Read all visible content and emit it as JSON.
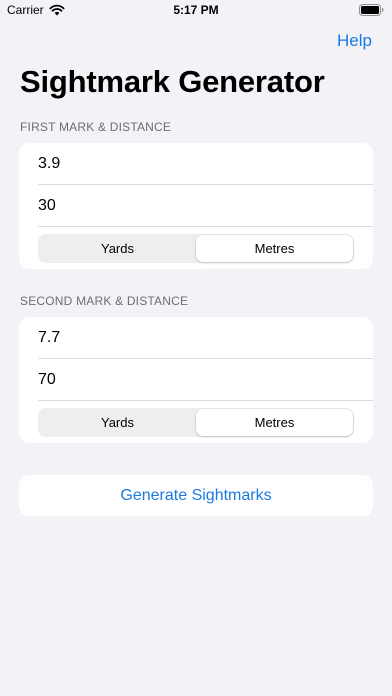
{
  "status_bar": {
    "carrier": "Carrier",
    "time": "5:17 PM"
  },
  "nav": {
    "help_label": "Help"
  },
  "page": {
    "title": "Sightmark Generator"
  },
  "first": {
    "header": "FIRST MARK & DISTANCE",
    "mark_value": "3.9",
    "distance_value": "30",
    "units": [
      "Yards",
      "Metres"
    ],
    "selected_unit": "Metres"
  },
  "second": {
    "header": "SECOND MARK & DISTANCE",
    "mark_value": "7.7",
    "distance_value": "70",
    "units": [
      "Yards",
      "Metres"
    ],
    "selected_unit": "Metres"
  },
  "actions": {
    "generate_label": "Generate Sightmarks"
  },
  "colors": {
    "accent": "#1a7ae2",
    "background": "#f2f2f7",
    "card": "#ffffff",
    "section_header": "#6d6d72"
  },
  "icons": [
    "wifi-icon",
    "battery-icon"
  ]
}
